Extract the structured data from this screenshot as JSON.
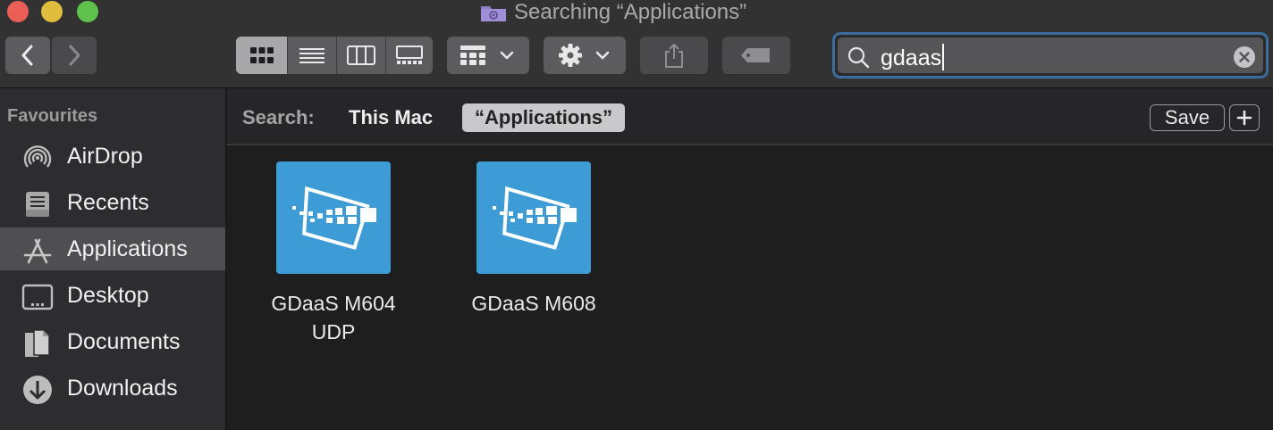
{
  "window": {
    "title": "Searching “Applications”",
    "folder_icon": "smart-folder-icon"
  },
  "toolbar": {
    "back_icon": "chevron-left-icon",
    "forward_icon": "chevron-right-icon",
    "view_modes": [
      "icon-view",
      "list-view",
      "column-view",
      "gallery-view"
    ],
    "selected_view": "icon-view",
    "group_icon": "group-by-icon",
    "action_icon": "gear-icon",
    "share_icon": "share-icon",
    "tag_icon": "tag-icon"
  },
  "search": {
    "value": "gdaas",
    "search_icon": "magnifier-icon",
    "clear_icon": "clear-circle-icon"
  },
  "sidebar": {
    "heading": "Favourites",
    "items": [
      {
        "label": "AirDrop",
        "icon": "airdrop-icon"
      },
      {
        "label": "Recents",
        "icon": "recents-icon"
      },
      {
        "label": "Applications",
        "icon": "applications-icon",
        "selected": true
      },
      {
        "label": "Desktop",
        "icon": "desktop-icon"
      },
      {
        "label": "Documents",
        "icon": "documents-icon"
      },
      {
        "label": "Downloads",
        "icon": "downloads-icon"
      }
    ]
  },
  "scope": {
    "label": "Search:",
    "this_mac": "This Mac",
    "selected": "“Applications”",
    "save_label": "Save",
    "add_icon": "plus-icon"
  },
  "results": [
    {
      "name_line1": "GDaaS M604",
      "name_line2": "UDP",
      "icon": "gdaas-app-icon"
    },
    {
      "name_line1": "GDaaS M608",
      "name_line2": "",
      "icon": "gdaas-app-icon"
    }
  ],
  "colors": {
    "app_icon_bg": "#3d9bd6",
    "search_focus": "#3b6e9e",
    "sidebar_selected": "#4f4f51"
  }
}
